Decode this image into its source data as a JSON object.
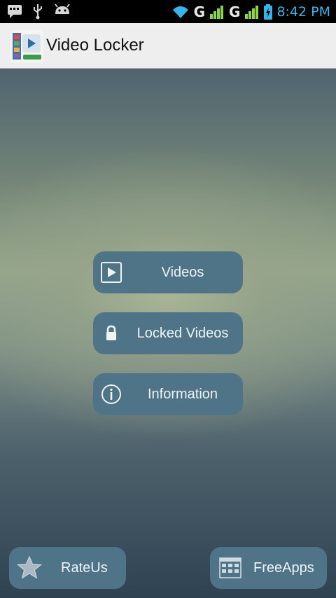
{
  "status_bar": {
    "network_1": "G",
    "network_2": "G",
    "time": "8:42 PM"
  },
  "app_bar": {
    "title": "Video Locker"
  },
  "menu": {
    "videos": "Videos",
    "locked_videos": "Locked Videos",
    "information": "Information"
  },
  "bottom": {
    "rate_us": "RateUs",
    "free_apps": "FreeApps"
  },
  "colors": {
    "button_bg": "#4f7488",
    "status_accent": "#39b4e8",
    "app_bar_bg": "#eeeeee"
  },
  "icons": {
    "videos": "play-icon",
    "locked_videos": "lock-icon",
    "information": "info-icon",
    "rate_us": "star-icon",
    "free_apps": "apps-grid-icon"
  }
}
